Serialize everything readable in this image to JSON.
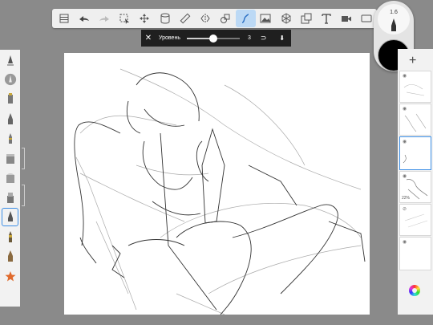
{
  "toolbar": {
    "items": [
      {
        "name": "gallery-icon"
      },
      {
        "name": "undo-icon"
      },
      {
        "name": "redo-icon"
      },
      {
        "name": "selection-icon"
      },
      {
        "name": "transform-icon"
      },
      {
        "name": "layers-stack-icon"
      },
      {
        "name": "ruler-icon"
      },
      {
        "name": "symmetry-icon"
      },
      {
        "name": "shapes-icon"
      },
      {
        "name": "steady-stroke-icon",
        "active": true
      },
      {
        "name": "image-icon"
      },
      {
        "name": "perspective-icon"
      },
      {
        "name": "import-icon"
      },
      {
        "name": "text-icon"
      },
      {
        "name": "video-icon"
      },
      {
        "name": "fullscreen-icon"
      }
    ]
  },
  "level": {
    "label": "Уровень",
    "value": "3",
    "fraction": 0.5
  },
  "brush": {
    "size": "1.6",
    "color": "#000000"
  },
  "left_tools": [
    {
      "name": "brush-library-icon"
    },
    {
      "name": "pencil-brush-icon"
    },
    {
      "name": "marker-icon"
    },
    {
      "name": "ink-pen-icon"
    },
    {
      "name": "ballpoint-icon"
    },
    {
      "name": "airbrush-icon"
    },
    {
      "name": "eraser-icon"
    },
    {
      "name": "smudge-icon"
    },
    {
      "name": "fineliner-icon",
      "selected": true
    },
    {
      "name": "paintbrush-icon"
    },
    {
      "name": "chisel-icon"
    },
    {
      "name": "favorite-star-icon"
    }
  ],
  "layers": [
    {
      "visible": "◉",
      "opacity": ""
    },
    {
      "visible": "◉",
      "opacity": ""
    },
    {
      "visible": "◉",
      "opacity": "",
      "selected": true
    },
    {
      "visible": "◉",
      "opacity": "22%"
    },
    {
      "visible": "⊘",
      "opacity": ""
    },
    {
      "visible": "◉",
      "opacity": ""
    }
  ],
  "colors": {
    "accent": "#3b8ee6",
    "toolbar_bg": "#efefef",
    "canvas_bg": "#ffffff",
    "workspace_bg": "#8a8a8a"
  }
}
